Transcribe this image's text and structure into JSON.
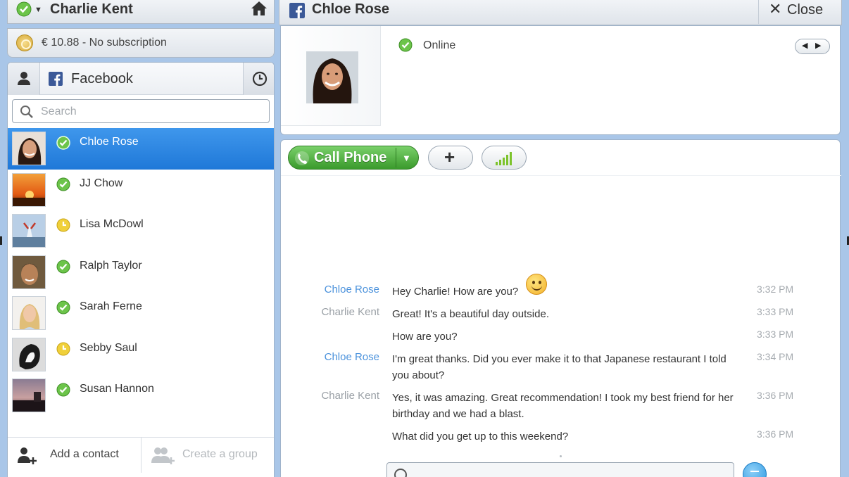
{
  "account": {
    "name": "Charlie Kent",
    "credit": "€ 10.88 - No subscription"
  },
  "contacts_panel": {
    "tab_label": "Facebook",
    "search_placeholder": "Search",
    "contacts": [
      {
        "name": "Chloe Rose",
        "status": "online",
        "selected": true
      },
      {
        "name": "JJ Chow",
        "status": "online",
        "selected": false
      },
      {
        "name": "Lisa McDowl",
        "status": "away",
        "selected": false
      },
      {
        "name": "Ralph Taylor",
        "status": "online",
        "selected": false
      },
      {
        "name": "Sarah Ferne",
        "status": "online",
        "selected": false
      },
      {
        "name": "Sebby Saul",
        "status": "away",
        "selected": false
      },
      {
        "name": "Susan Hannon",
        "status": "online",
        "selected": false
      }
    ],
    "add_contact_label": "Add a contact",
    "create_group_label": "Create a group"
  },
  "conversation": {
    "title": "Chloe Rose",
    "close_label": "Close",
    "profile_status": "Online",
    "call_label": "Call Phone",
    "messages": [
      {
        "sender": "Chloe Rose",
        "text": "Hey Charlie! How are you?",
        "time": "3:32 PM"
      },
      {
        "sender": "Charlie Kent",
        "text": "Great! It's a beautiful day outside.",
        "time": "3:33 PM"
      },
      {
        "sender": "",
        "text": "How are you?",
        "time": "3:33 PM"
      },
      {
        "sender": "Chloe Rose",
        "text": "I'm great thanks. Did you ever make it to that Japanese restaurant I told you about?",
        "time": "3:34 PM"
      },
      {
        "sender": "Charlie Kent",
        "text": "Yes, it was amazing. Great recommendation! I took my best friend for her birthday and we had a blast.",
        "time": "3:36 PM"
      },
      {
        "sender": "",
        "text": "What did you get up to this weekend?",
        "time": "3:36 PM"
      }
    ]
  },
  "colors": {
    "window_bg": "#a9c6e8",
    "selected_row": "#1f78d8",
    "online_green": "#6cc44a",
    "away_yellow": "#f0d03a",
    "call_green": "#3a9a2c",
    "sender_chloe": "#4b92dc",
    "sender_charlie": "#9aa0a6"
  },
  "icons": {
    "home": "home-icon",
    "facebook": "facebook-icon",
    "search": "search-icon",
    "history": "clock-icon",
    "person": "person-icon",
    "phone": "phone-icon",
    "signal": "signal-icon",
    "emoticon": "smiley-icon"
  }
}
